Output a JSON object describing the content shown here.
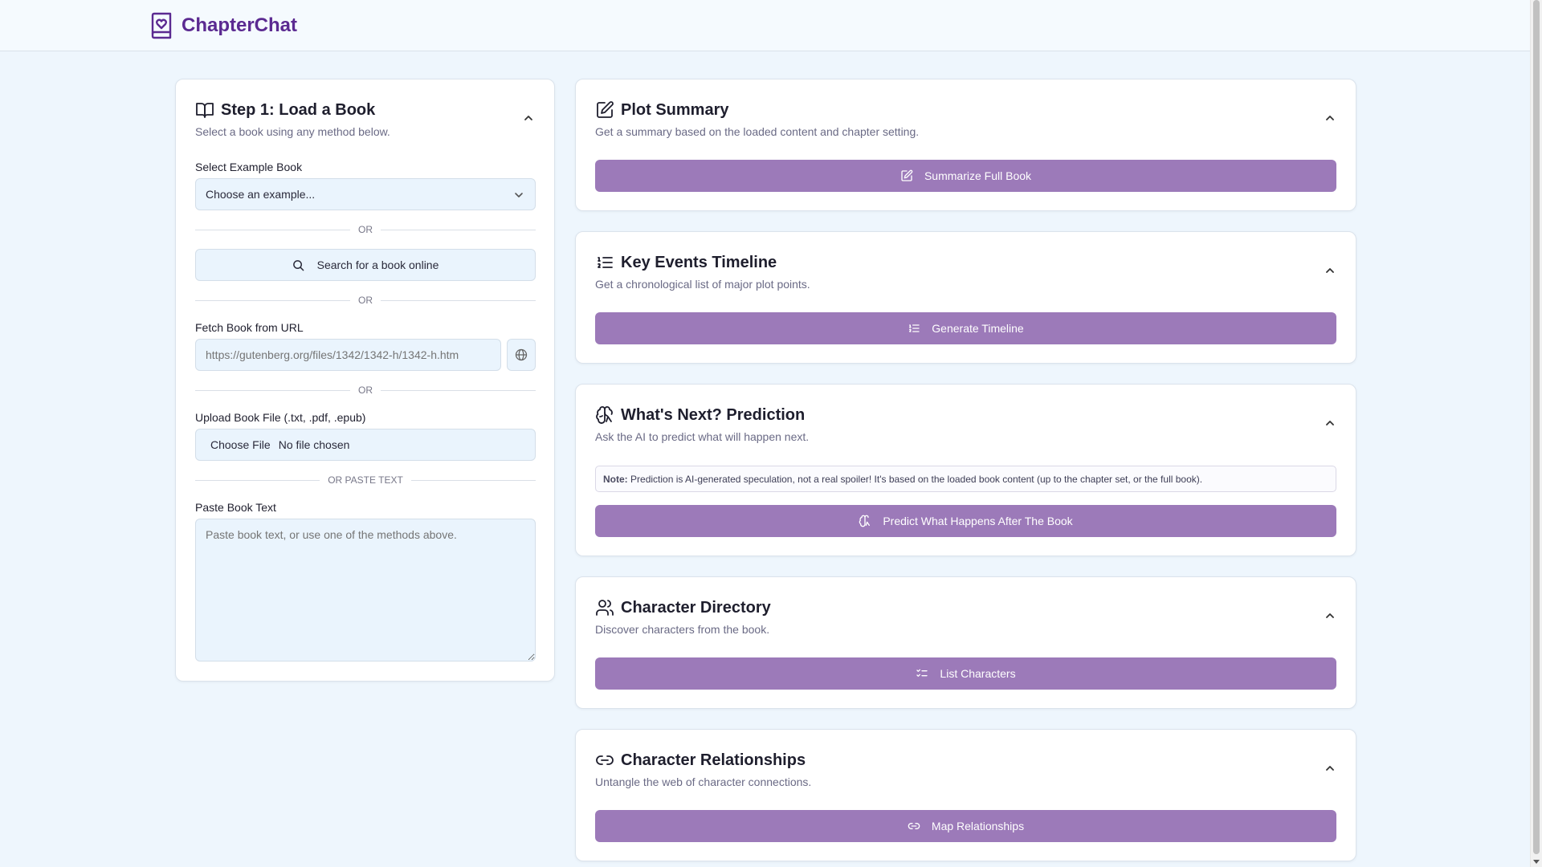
{
  "app": {
    "title": "ChapterChat",
    "brand_color": "#5b2a91",
    "accent": "#9c7ab9"
  },
  "load_card": {
    "title": "Step 1: Load a Book",
    "description": "Select a book using any method below.",
    "example_label": "Select Example Book",
    "example_selected": "Choose an example...",
    "or_1": "OR",
    "search_button": "Search for a book online",
    "or_2": "OR",
    "url_label": "Fetch Book from URL",
    "url_placeholder": "https://gutenberg.org/files/1342/1342-h/1342-h.htm",
    "or_3": "OR",
    "upload_label": "Upload Book File (.txt, .pdf, .epub)",
    "choose_file": "Choose File",
    "no_file": "No file chosen",
    "or_paste": "OR PASTE TEXT",
    "paste_label": "Paste Book Text",
    "paste_placeholder": "Paste book text, or use one of the methods above."
  },
  "panels": [
    {
      "icon": "edit-note-icon",
      "title": "Plot Summary",
      "description": "Get a summary based on the loaded content and chapter setting.",
      "button": "Summarize Full Book"
    },
    {
      "icon": "list-ordered-icon",
      "title": "Key Events Timeline",
      "description": "Get a chronological list of major plot points.",
      "button": "Generate Timeline"
    },
    {
      "icon": "brain-icon",
      "title": "What's Next? Prediction",
      "description": "Ask the AI to predict what will happen next.",
      "note_label": "Note:",
      "note_text": "Prediction is AI-generated speculation, not a real spoiler! It's based on the loaded book content (up to the chapter set, or the full book).",
      "button": "Predict What Happens After The Book"
    },
    {
      "icon": "users-icon",
      "title": "Character Directory",
      "description": "Discover characters from the book.",
      "button": "List Characters"
    },
    {
      "icon": "link-icon",
      "title": "Character Relationships",
      "description": "Untangle the web of character connections.",
      "button": "Map Relationships"
    }
  ]
}
